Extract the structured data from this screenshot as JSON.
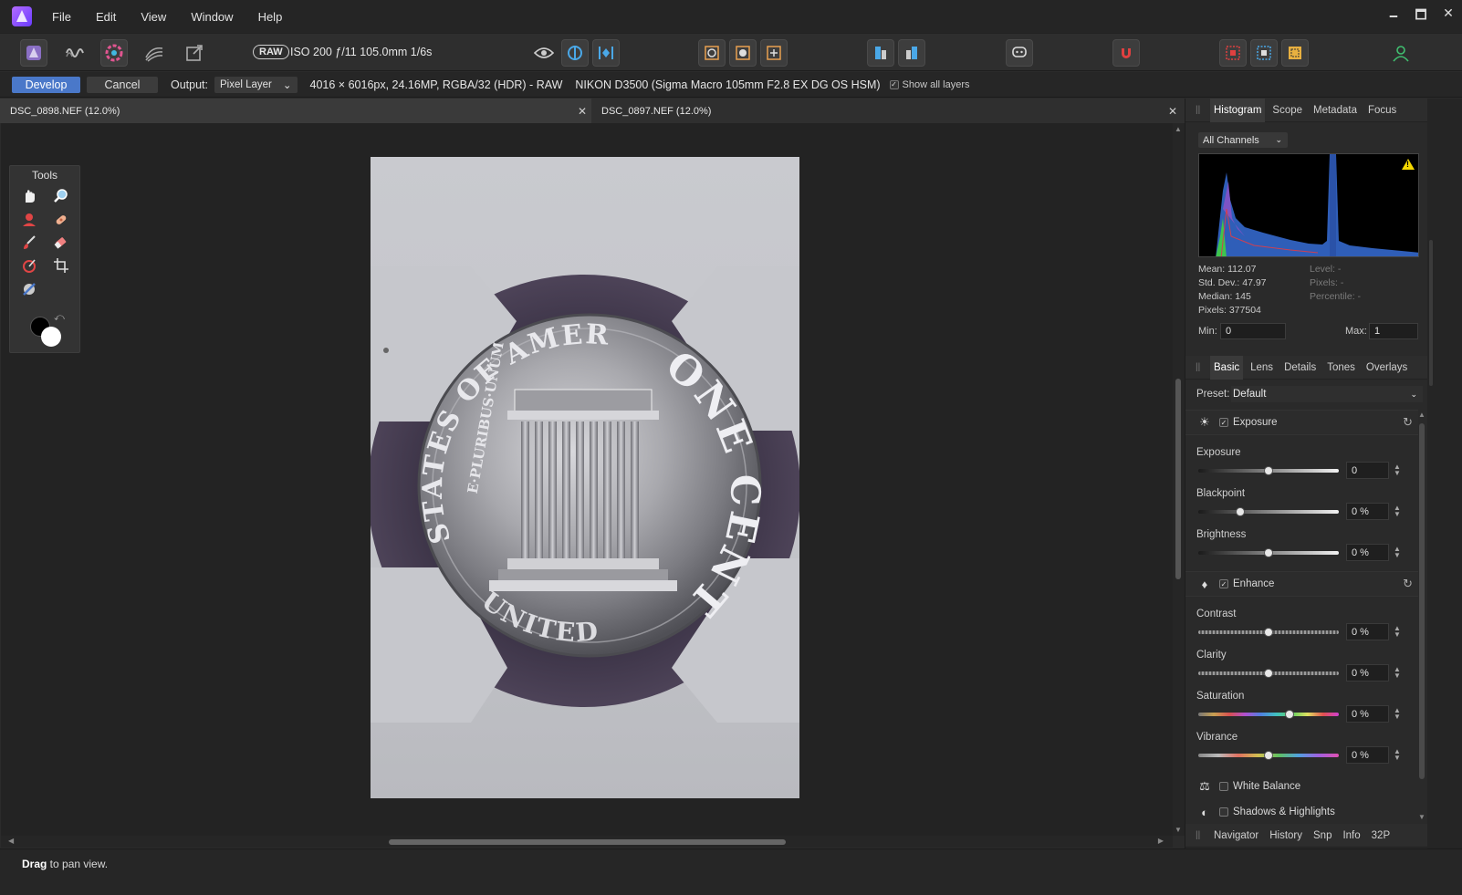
{
  "menubar": {
    "items": [
      "File",
      "Edit",
      "View",
      "Window",
      "Help"
    ]
  },
  "window_controls": {
    "minimize": "🗕",
    "maximize": "🗖",
    "close": "✕"
  },
  "toolbar": {
    "raw_badge": "RAW",
    "exif": "ISO 200 ƒ/11 105.0mm 1/6s"
  },
  "context": {
    "develop": "Develop",
    "cancel": "Cancel",
    "output_label": "Output:",
    "output_value": "Pixel Layer",
    "image_info": "4016 × 6016px, 24.16MP, RGBA/32 (HDR) - RAW",
    "camera_info": "NIKON D3500 (Sigma Macro 105mm F2.8 EX DG OS HSM)",
    "show_all_layers": "Show all layers"
  },
  "doctabs": [
    {
      "name": "DSC_0898.NEF (12.0%)"
    },
    {
      "name": "DSC_0897.NEF (12.0%)"
    }
  ],
  "tools": {
    "title": "Tools"
  },
  "status": {
    "bold": "Drag",
    "text": " to pan view."
  },
  "histogram_panel": {
    "tabs": [
      "Histogram",
      "Scope",
      "Metadata",
      "Focus"
    ],
    "channel": "All Channels",
    "stats_left": [
      "Mean: 112.07",
      "Std. Dev.: 47.97",
      "Median: 145",
      "Pixels: 377504"
    ],
    "stats_right": [
      "Level: -",
      "Pixels: -",
      "Percentile: -"
    ],
    "min_label": "Min:",
    "min_value": "0",
    "max_label": "Max:",
    "max_value": "1"
  },
  "adjust_panel": {
    "tabs": [
      "Basic",
      "Lens",
      "Details",
      "Tones",
      "Overlays"
    ],
    "preset_label": "Preset:",
    "preset_value": "Default",
    "exposure_section": "Exposure",
    "enhance_section": "Enhance",
    "white_balance": "White Balance",
    "shadows_highlights": "Shadows & Highlights",
    "sliders": {
      "exposure": {
        "label": "Exposure",
        "value": "0",
        "pos": 0.5
      },
      "blackpoint": {
        "label": "Blackpoint",
        "value": "0 %",
        "pos": 0.3
      },
      "brightness": {
        "label": "Brightness",
        "value": "0 %",
        "pos": 0.5
      },
      "contrast": {
        "label": "Contrast",
        "value": "0 %",
        "pos": 0.5
      },
      "clarity": {
        "label": "Clarity",
        "value": "0 %",
        "pos": 0.5
      },
      "saturation": {
        "label": "Saturation",
        "value": "0 %",
        "pos": 0.65
      },
      "vibrance": {
        "label": "Vibrance",
        "value": "0 %",
        "pos": 0.5
      }
    }
  },
  "bottom_panel": {
    "tabs": [
      "Navigator",
      "History",
      "Snp",
      "Info",
      "32P"
    ]
  },
  "coin": {
    "top_text": "STATES OF AMERICA",
    "bottom_text": "UNITED",
    "right_text": "ONE CENT",
    "motto": "E·PLURIBUS·UNUM"
  },
  "colors": {
    "accent": "#4a78c9",
    "warning": "#f5d800"
  }
}
